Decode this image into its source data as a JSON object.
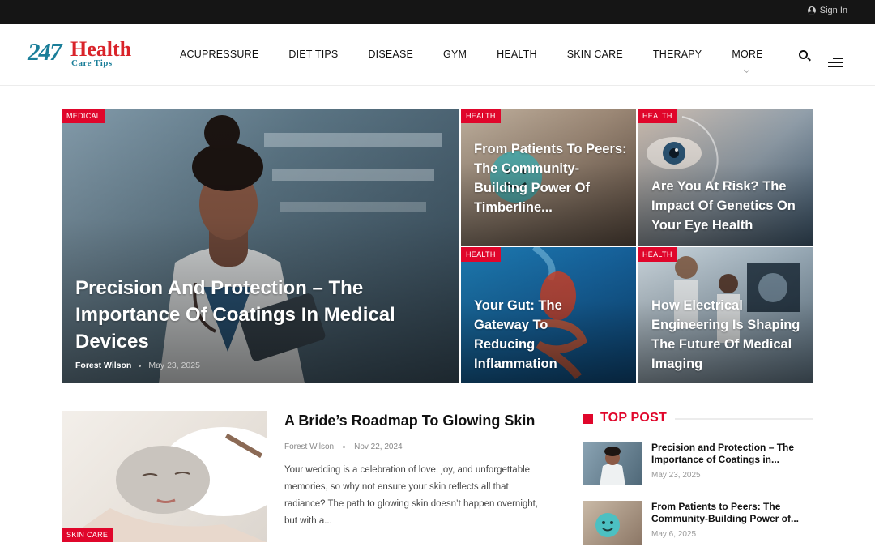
{
  "topbar": {
    "signin_label": "Sign In"
  },
  "logo": {
    "number": "247",
    "word": "Health",
    "tagline": "Care Tips"
  },
  "nav": {
    "items": [
      "ACUPRESSURE",
      "DIET TIPS",
      "DISEASE",
      "GYM",
      "HEALTH",
      "SKIN CARE",
      "THERAPY",
      "MORE"
    ]
  },
  "hero": {
    "main": {
      "category": "MEDICAL",
      "title": "Precision And Protection – The Importance Of Coatings In Medical Devices",
      "author": "Forest Wilson",
      "date": "May 23, 2025"
    },
    "cards": [
      {
        "category": "HEALTH",
        "title": "From Patients To Peers: The Community-Building Power Of Timberline..."
      },
      {
        "category": "HEALTH",
        "title": "Are You At Risk? The Impact Of Genetics On Your Eye Health"
      },
      {
        "category": "HEALTH",
        "title": "Your Gut: The Gateway To Reducing Inflammation"
      },
      {
        "category": "HEALTH",
        "title": "How Electrical Engineering Is Shaping The Future Of Medical Imaging"
      }
    ]
  },
  "featured": {
    "category": "SKIN CARE",
    "title": "A Bride’s Roadmap To Glowing Skin",
    "author": "Forest Wilson",
    "date": "Nov 22, 2024",
    "excerpt": "Your wedding is a celebration of love, joy, and unforgettable memories, so why not ensure your skin reflects all that radiance? The path to glowing skin doesn’t happen overnight, but with a..."
  },
  "top_post": {
    "heading": "TOP POST",
    "items": [
      {
        "title": "Precision and Protection – The Importance of Coatings in...",
        "date": "May 23, 2025"
      },
      {
        "title": "From Patients to Peers: The Community-Building Power of...",
        "date": "May 6, 2025"
      }
    ]
  },
  "colors": {
    "accent": "#e0062b",
    "logo_blue": "#1a7e99",
    "topbar": "#151515"
  }
}
